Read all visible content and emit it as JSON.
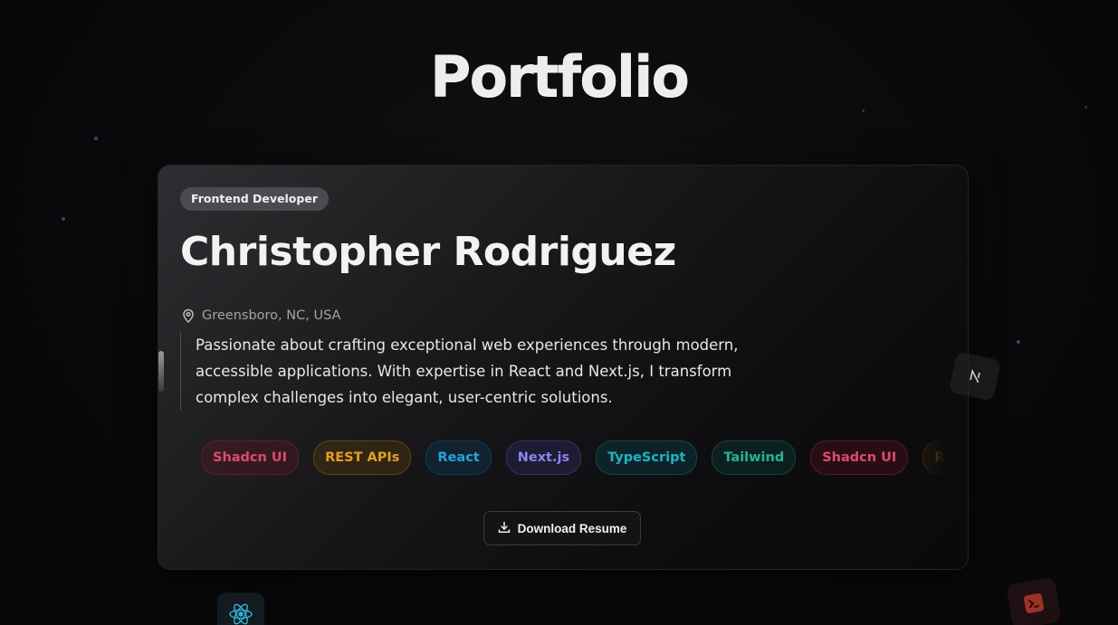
{
  "page": {
    "title": "Portfolio"
  },
  "profile": {
    "role": "Frontend Developer",
    "name": "Christopher Rodriguez",
    "location": "Greensboro, NC, USA",
    "bio": "Passionate about crafting exceptional web experiences through modern, accessible applications. With expertise in React and Next.js, I transform complex challenges into elegant, user-centric solutions."
  },
  "tags": [
    {
      "label": "Shadcn UI",
      "color": "#e04a6a"
    },
    {
      "label": "REST APIs",
      "color": "#e6a019"
    },
    {
      "label": "React",
      "color": "#1fa6e0"
    },
    {
      "label": "Next.js",
      "color": "#8a84f0"
    },
    {
      "label": "TypeScript",
      "color": "#14b8c8"
    },
    {
      "label": "Tailwind",
      "color": "#18b89a"
    },
    {
      "label": "Shadcn UI",
      "color": "#e04a6a"
    },
    {
      "label": "REST APIs",
      "color": "#e6a019"
    }
  ],
  "actions": {
    "download_label": "Download Resume"
  },
  "icons": {
    "location": "map-pin-icon",
    "download": "download-icon",
    "floating": [
      "nextjs-icon",
      "react-icon",
      "redux-icon"
    ]
  }
}
